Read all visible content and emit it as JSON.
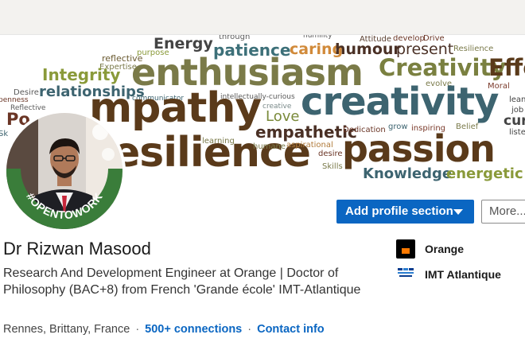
{
  "cover": {
    "words": [
      {
        "text": "Energy",
        "color": "#444444"
      },
      {
        "text": "through",
        "color": "#5a5a5a"
      },
      {
        "text": "humility",
        "color": "#5a5a5a"
      },
      {
        "text": "Attitude",
        "color": "#5a4030"
      },
      {
        "text": "develop",
        "color": "#6a3525"
      },
      {
        "text": "Drive",
        "color": "#6a3525"
      },
      {
        "text": "reflective",
        "color": "#6a5a30"
      },
      {
        "text": "purpose",
        "color": "#8a9a3a"
      },
      {
        "text": "patience",
        "color": "#3d7079"
      },
      {
        "text": "caring",
        "color": "#d18a3a"
      },
      {
        "text": "humour",
        "color": "#4a3025"
      },
      {
        "text": "present",
        "color": "#4a3025"
      },
      {
        "text": "Resilience",
        "color": "#7a7a4a"
      },
      {
        "text": "Expertise",
        "color": "#7a7a4a"
      },
      {
        "text": "Integrity",
        "color": "#8a9a3a"
      },
      {
        "text": "enthusiasm",
        "color": "#7a7a48"
      },
      {
        "text": "Creativity",
        "color": "#7a8040"
      },
      {
        "text": "Effe",
        "color": "#5a3a1a"
      },
      {
        "text": "Desire",
        "color": "#5a5a5a"
      },
      {
        "text": "relationships",
        "color": "#3d6470"
      },
      {
        "text": "communicator",
        "color": "#3d6470"
      },
      {
        "text": "intellectually-curious",
        "color": "#5a5a5a"
      },
      {
        "text": "creative",
        "color": "#7a8a8a"
      },
      {
        "text": "evolve",
        "color": "#7a7a4a"
      },
      {
        "text": "Moral",
        "color": "#7a3a2a"
      },
      {
        "text": "penness",
        "color": "#6a3525"
      },
      {
        "text": "Reflective",
        "color": "#5a5a5a"
      },
      {
        "text": "mpathy",
        "color": "#5a3a1a"
      },
      {
        "text": "Love",
        "color": "#7a8a3a"
      },
      {
        "text": "creativity",
        "color": "#3d6470"
      },
      {
        "text": "lean",
        "color": "#444444"
      },
      {
        "text": "job",
        "color": "#444444"
      },
      {
        "text": "Po",
        "color": "#6a3525"
      },
      {
        "text": "empathetic",
        "color": "#4a3025"
      },
      {
        "text": "Dedication",
        "color": "#6a3525"
      },
      {
        "text": "grow",
        "color": "#3d6470"
      },
      {
        "text": "inspiring",
        "color": "#7a3a2a"
      },
      {
        "text": "Belief",
        "color": "#7a7a4a"
      },
      {
        "text": "cur",
        "color": "#444444"
      },
      {
        "text": "listen",
        "color": "#444444"
      },
      {
        "text": "Sk",
        "color": "#3d6470"
      },
      {
        "text": "esilience",
        "color": "#5a3a1a"
      },
      {
        "text": "learning",
        "color": "#7a7a4a"
      },
      {
        "text": "humane",
        "color": "#7a7a4a"
      },
      {
        "text": "aspirational",
        "color": "#b07a3a"
      },
      {
        "text": "passion",
        "color": "#5a3a1a"
      },
      {
        "text": "desire",
        "color": "#6a3525"
      },
      {
        "text": "Skills",
        "color": "#7a7a4a"
      },
      {
        "text": "Knowledge",
        "color": "#3d6470"
      },
      {
        "text": "energetic",
        "color": "#8a9a3a"
      }
    ]
  },
  "avatar": {
    "badge_text": "#OPENTOWORK",
    "badge_color": "#3a7d3a"
  },
  "actions": {
    "add_section_label": "Add profile section",
    "more_label": "More..."
  },
  "profile": {
    "name": "Dr Rizwan Masood",
    "headline": "Research And Development Engineer at Orange | Doctor of Philosophy (BAC+8) from French 'Grande école' IMT-Atlantique",
    "location": "Rennes, Brittany, France",
    "separator": "·",
    "connections": "500+ connections",
    "contact_info": "Contact info"
  },
  "organizations": [
    {
      "name": "Orange",
      "logo": "orange-logo",
      "color": "#ff7900"
    },
    {
      "name": "IMT Atlantique",
      "logo": "imt-atlantique-logo",
      "color": "#0a3d8f"
    }
  ],
  "colors": {
    "accent": "#0a66c2",
    "topbar": "#f3f2ef"
  }
}
